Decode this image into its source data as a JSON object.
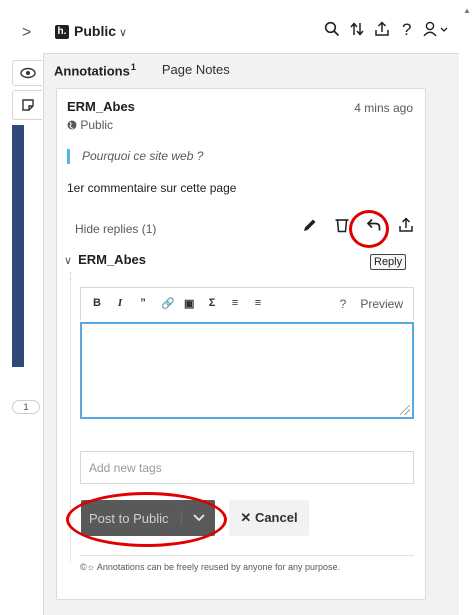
{
  "sidebar": {
    "expand_glyph": ">",
    "count_bubble": "1"
  },
  "topbar": {
    "group_label": "Public",
    "logo_letter": "h."
  },
  "tabs": {
    "annotations_label": "Annotations",
    "annotations_count": "1",
    "page_notes_label": "Page Notes"
  },
  "annotation": {
    "author": "ERM_Abes",
    "visibility": "Public",
    "timestamp": "4 mins ago",
    "quote": "Pourquoi ce site web ?",
    "comment": "1er commentaire sur cette page",
    "hide_replies": "Hide replies (1)",
    "reply_tooltip": "Reply"
  },
  "reply": {
    "author": "ERM_Abes",
    "preview_label": "Preview",
    "help_label": "?",
    "editor_value": "",
    "tags_placeholder": "Add new tags",
    "post_label": "Post to Public",
    "cancel_label": "Cancel",
    "license_text": "Annotations can be freely reused by anyone for any purpose."
  },
  "colors": {
    "accent_blue": "#59a6e1",
    "highlight_red": "#e00000",
    "post_button": "#595959",
    "side_bar": "#2f4a78"
  }
}
